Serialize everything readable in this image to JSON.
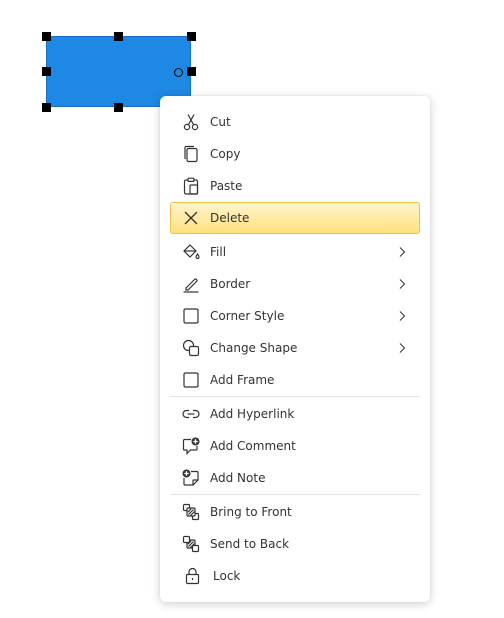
{
  "shape": {
    "fill_color": "#1e88e5"
  },
  "menu": {
    "highlight_color": "#ffe17a",
    "items": [
      {
        "label": "Cut",
        "icon": "scissors-icon"
      },
      {
        "label": "Copy",
        "icon": "copy-icon"
      },
      {
        "label": "Paste",
        "icon": "paste-icon"
      },
      {
        "label": "Delete",
        "icon": "close-icon",
        "highlighted": true
      },
      {
        "label": "Fill",
        "icon": "paint-bucket-icon",
        "submenu": true
      },
      {
        "label": "Border",
        "icon": "pen-icon",
        "submenu": true
      },
      {
        "label": "Corner Style",
        "icon": "square-icon",
        "submenu": true
      },
      {
        "label": "Change Shape",
        "icon": "shapes-icon",
        "submenu": true
      },
      {
        "label": "Add Frame",
        "icon": "frame-icon"
      },
      {
        "label": "Add Hyperlink",
        "icon": "link-icon"
      },
      {
        "label": "Add Comment",
        "icon": "comment-add-icon"
      },
      {
        "label": "Add Note",
        "icon": "note-add-icon"
      },
      {
        "label": "Bring to Front",
        "icon": "bring-to-front-icon"
      },
      {
        "label": "Send to Back",
        "icon": "send-to-back-icon"
      },
      {
        "label": "Lock",
        "icon": "lock-icon"
      }
    ]
  }
}
